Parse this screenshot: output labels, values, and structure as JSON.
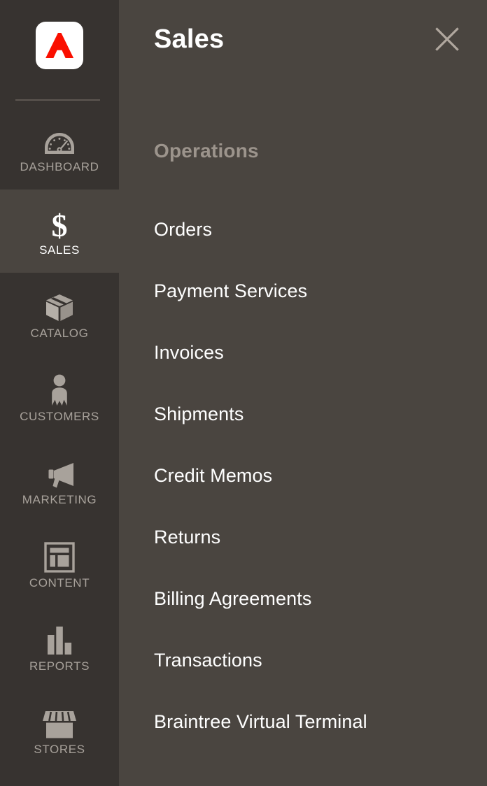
{
  "sidebar": {
    "logo": {
      "icon": "adobe-logo-icon",
      "color": "#fa0f00"
    },
    "items": [
      {
        "label": "DASHBOARD",
        "icon": "gauge-icon",
        "active": false
      },
      {
        "label": "SALES",
        "icon": "dollar-sign-icon",
        "active": true
      },
      {
        "label": "CATALOG",
        "icon": "box-icon",
        "active": false
      },
      {
        "label": "CUSTOMERS",
        "icon": "person-icon",
        "active": false
      },
      {
        "label": "MARKETING",
        "icon": "megaphone-icon",
        "active": false
      },
      {
        "label": "CONTENT",
        "icon": "page-layout-icon",
        "active": false
      },
      {
        "label": "REPORTS",
        "icon": "bar-chart-icon",
        "active": false
      },
      {
        "label": "STORES",
        "icon": "storefront-icon",
        "active": false
      }
    ]
  },
  "panel": {
    "title": "Sales",
    "close_icon": "close-icon",
    "section_title": "Operations",
    "menu_items": [
      {
        "label": "Orders"
      },
      {
        "label": "Payment Services"
      },
      {
        "label": "Invoices"
      },
      {
        "label": "Shipments"
      },
      {
        "label": "Credit Memos"
      },
      {
        "label": "Returns"
      },
      {
        "label": "Billing Agreements"
      },
      {
        "label": "Transactions"
      },
      {
        "label": "Braintree Virtual Terminal"
      }
    ]
  },
  "colors": {
    "rail_background": "#373330",
    "panel_background": "#4a4540",
    "accent_red": "#fa0f00",
    "icon_gray": "#a8a29b",
    "muted_text": "#9c948c"
  }
}
